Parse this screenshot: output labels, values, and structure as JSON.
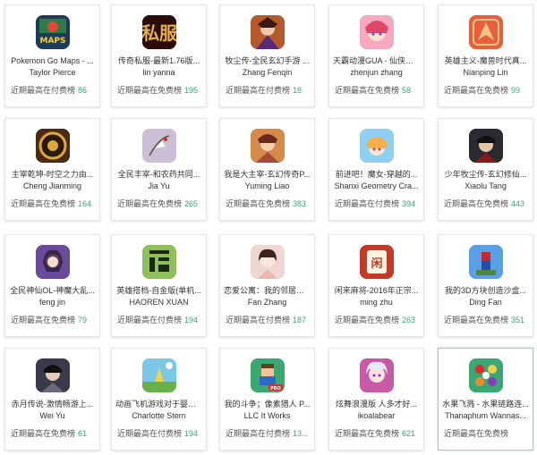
{
  "rank_label_paid": "近期最高在付费榜",
  "rank_label_free": "近期最高在免费榜",
  "accent_color": "#3aa872",
  "apps": [
    {
      "title": "Pokemon Go Maps - ...",
      "author": "Taylor Pierce",
      "rank_label": "近期最高在付费榜",
      "rank": "86",
      "icon": "pokemon-maps-icon",
      "color": "#1d3a56"
    },
    {
      "title": "传奇私服-最新1.76版...",
      "author": "lin yanna",
      "rank_label": "近期最高在免费榜",
      "rank": "195",
      "icon": "sifu-calligraphy-icon",
      "color": "#2a0c08"
    },
    {
      "title": "牧尘传-全民玄幻手游 ...",
      "author": "Zhang Fenqin",
      "rank_label": "近期最高在付费榜",
      "rank": "18",
      "icon": "fantasy-warrior-icon",
      "color": "#b65a2c"
    },
    {
      "title": "天霸动漫GUA - 仙侠幽...",
      "author": "zhenjun zhang",
      "rank_label": "近期最高在免费榜",
      "rank": "58",
      "icon": "anime-girl-icon",
      "color": "#e0456a"
    },
    {
      "title": "英雄主义-魔兽时代真...",
      "author": "Nianping Lin",
      "rank_label": "近期最高在免费榜",
      "rank": "99",
      "icon": "wing-emblem-icon",
      "color": "#e8603a"
    },
    {
      "title": "主宰乾坤-时空之力由...",
      "author": "Cheng Jianming",
      "rank_label": "近期最高在免费榜",
      "rank": "164",
      "icon": "golden-seal-icon",
      "color": "#4a2c12"
    },
    {
      "title": "全民丰宰-和农药共同...",
      "author": "Jia Yu",
      "rank_label": "近期最高在免费榜",
      "rank": "265",
      "icon": "crane-painting-icon",
      "color": "#b7a7c8"
    },
    {
      "title": "我是大主宰-玄幻传奇P...",
      "author": "Yuming Liao",
      "rank_label": "近期最高在免费榜",
      "rank": "383",
      "icon": "hero-portrait-icon",
      "color": "#a64a3c"
    },
    {
      "title": "前进吧！魔女-穿越的...",
      "author": "Shanxi Geometry Cra...",
      "rank_label": "近期最高在付费榜",
      "rank": "394",
      "icon": "witch-girl-icon",
      "color": "#f2b14c"
    },
    {
      "title": "少年牧尘传-玄幻修仙...",
      "author": "Xiaolu Tang",
      "rank_label": "近期最高在免费榜",
      "rank": "443",
      "icon": "dark-hero-icon",
      "color": "#3a2a2a"
    },
    {
      "title": "全民神仙OL-神魔大乱...",
      "author": "feng jin",
      "rank_label": "近期最高在免费榜",
      "rank": "79",
      "icon": "fairy-lady-icon",
      "color": "#6a4a9a"
    },
    {
      "title": "英雄搭档-自金版(单机...",
      "author": "HAOREN XUAN",
      "rank_label": "近期最高在付费榜",
      "rank": "194",
      "icon": "pixel-glyph-icon",
      "color": "#6a9a3a"
    },
    {
      "title": "恋爱公寓：我的邻居，...",
      "author": "Fan Zhang",
      "rank_label": "近期最高在付费榜",
      "rank": "187",
      "icon": "lady-portrait-icon",
      "color": "#e6b8b0"
    },
    {
      "title": "闲来麻将-2016年正宗...",
      "author": "ming zhu",
      "rank_label": "近期最高在免费榜",
      "rank": "263",
      "icon": "mahjong-icon",
      "color": "#c43a2a"
    },
    {
      "title": "我的3D方块创造沙盒...",
      "author": "Ding Fan",
      "rank_label": "近期最高在免费榜",
      "rank": "351",
      "icon": "spider-hero-icon",
      "color": "#2a4aa6"
    },
    {
      "title": "赤月传说-激情畅游上...",
      "author": "Wei Yu",
      "rank_label": "近期最高在免费榜",
      "rank": "61",
      "icon": "swordsman-icon",
      "color": "#3a3a4a"
    },
    {
      "title": "动画飞机游戏对于婴儿...",
      "author": "Charlotte Stern",
      "rank_label": "近期最高在付费榜",
      "rank": "194",
      "icon": "sky-scene-icon",
      "color": "#7ac8e6"
    },
    {
      "title": "我的斗争；像素猎人 P...",
      "author": "LLC It Works",
      "rank_label": "近期最高在付费榜",
      "rank": "13...",
      "icon": "pixel-hunter-icon",
      "color": "#3aa872"
    },
    {
      "title": "炫舞浪漫版 人多才好...",
      "author": "ikoalabear",
      "rank_label": "近期最高在免费榜",
      "rank": "621",
      "icon": "dancer-girl-icon",
      "color": "#c65aa6"
    },
    {
      "title": "水果飞溅 - 水果链路连...",
      "author": "Thanaphum Wannas...",
      "rank_label": "近期最高在免费榜",
      "rank": "",
      "icon": "fruit-splash-icon",
      "color": "#e67a2a"
    }
  ]
}
